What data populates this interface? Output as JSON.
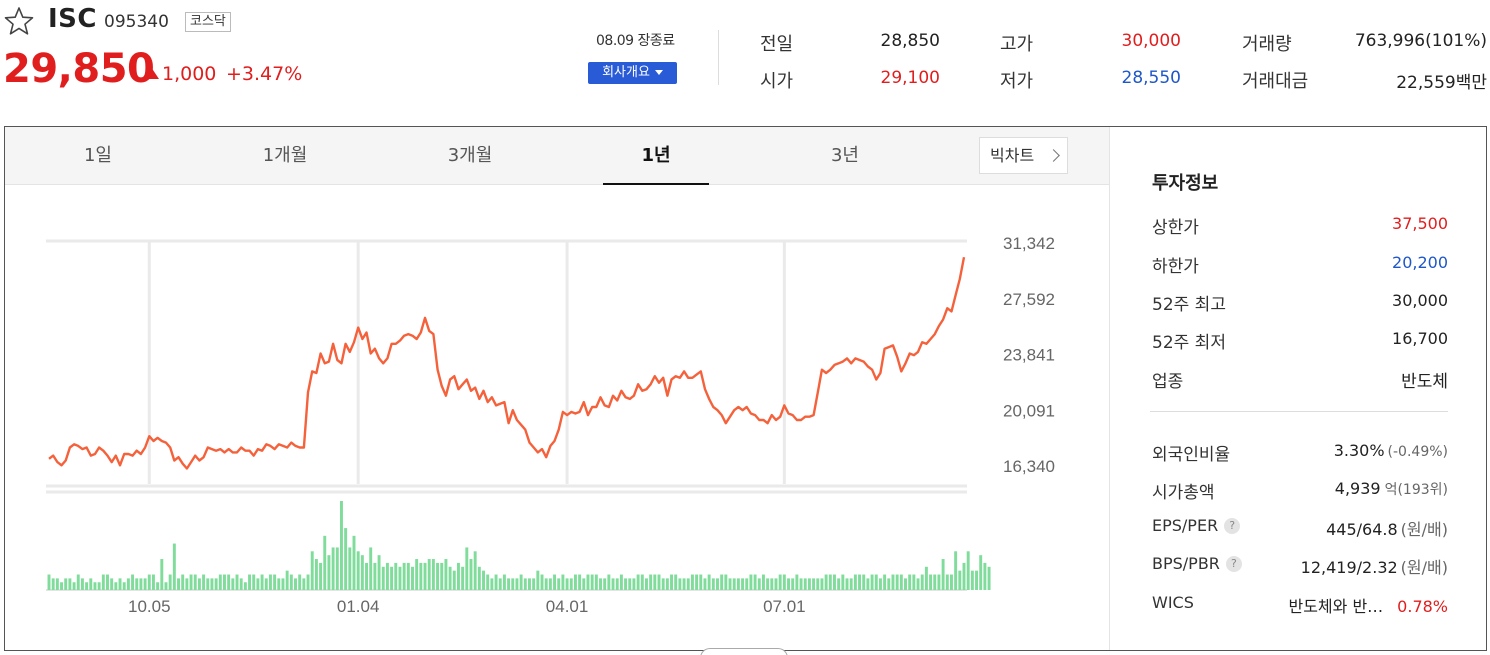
{
  "header": {
    "name": "ISC",
    "code": "095340",
    "market": "코스닥",
    "price": "29,850",
    "change": "1,000",
    "change_pct": "+3.47%",
    "trade_date": "08.09 장종료",
    "company_button": "회사개요",
    "stats": {
      "prev_close_label": "전일",
      "prev_close": "28,850",
      "open_label": "시가",
      "open": "29,100",
      "high_label": "고가",
      "high": "30,000",
      "low_label": "저가",
      "low": "28,550",
      "volume_label": "거래량",
      "volume": "763,996(101%)",
      "value_label": "거래대금",
      "value": "22,559백만"
    },
    "colors": {
      "up": "#e01e1e",
      "down": "#1e57c8",
      "accent": "#2a5bd7"
    }
  },
  "tabs": [
    "1일",
    "1개월",
    "3개월",
    "1년",
    "3년"
  ],
  "active_tab": "1년",
  "bigchart_label": "빅차트",
  "chart_data": {
    "type": "line",
    "title": "",
    "xlabel": "",
    "ylabel": "",
    "y_ticks": [
      "31,342",
      "27,592",
      "23,841",
      "20,091",
      "16,340"
    ],
    "ylim": [
      16340,
      31342
    ],
    "x_ticks": [
      "10.05",
      "01.04",
      "04.01",
      "07.01"
    ],
    "line_color": "#f5613b",
    "volume_color": "#7fdc9a",
    "grid": true,
    "series": [
      {
        "values": [
          17400,
          17600,
          17200,
          17000,
          17300,
          18100,
          18300,
          18200,
          18000,
          18100,
          17600,
          17700,
          18100,
          17900,
          17600,
          17200,
          17600,
          17000,
          17700,
          17700,
          17600,
          17900,
          17700,
          18100,
          18800,
          18500,
          18700,
          18500,
          18400,
          18100,
          17300,
          17500,
          17100,
          16800,
          17200,
          17600,
          17300,
          17500,
          18100,
          18000,
          17900,
          18000,
          17800,
          18000,
          17800,
          17800,
          18100,
          17900,
          17900,
          17600,
          18000,
          17900,
          18300,
          18200,
          18000,
          18300,
          18200,
          18100,
          18400,
          18200,
          18100,
          18100,
          21500,
          22800,
          22700,
          23900,
          23300,
          23400,
          24500,
          23500,
          23300,
          24500,
          24000,
          24600,
          25500,
          24800,
          25200,
          23900,
          24200,
          23600,
          23300,
          23600,
          24500,
          24500,
          24700,
          25000,
          25100,
          25000,
          24800,
          25200,
          26100,
          25300,
          25100,
          22900,
          21900,
          21300,
          22300,
          22500,
          21700,
          22000,
          22300,
          21600,
          21800,
          21100,
          21600,
          20900,
          21200,
          20700,
          20800,
          20900,
          19600,
          20400,
          19800,
          19500,
          19200,
          18400,
          18100,
          17800,
          18000,
          17500,
          18200,
          18500,
          19200,
          20300,
          20100,
          20300,
          20200,
          20300,
          20900,
          20100,
          20600,
          20600,
          21200,
          20700,
          20600,
          21300,
          21000,
          21600,
          21200,
          21100,
          21300,
          22000,
          21600,
          21700,
          22000,
          22500,
          22100,
          22400,
          21300,
          22300,
          22500,
          22400,
          22800,
          22400,
          22400,
          22600,
          22800,
          21700,
          21100,
          20600,
          20400,
          20100,
          19600,
          20000,
          20400,
          20600,
          20400,
          20600,
          20200,
          20100,
          19800,
          19800,
          19600,
          20100,
          19800,
          20000,
          20700,
          20200,
          20100,
          19800,
          19800,
          20000,
          20000,
          20100,
          21500,
          22900,
          22700,
          22900,
          23200,
          23300,
          23400,
          23600,
          23300,
          23600,
          23500,
          23400,
          23100,
          22900,
          22300,
          22700,
          24200,
          24300,
          24400,
          23700,
          22800,
          23300,
          23900,
          23800,
          24000,
          24600,
          24500,
          24800,
          25100,
          25600,
          26000,
          26700,
          26500,
          27500,
          28500,
          29850
        ]
      }
    ],
    "volume": [
      4,
      3,
      3,
      2,
      3,
      3,
      2,
      4,
      3,
      2,
      3,
      2,
      2,
      4,
      4,
      3,
      2,
      3,
      2,
      3,
      4,
      3,
      3,
      3,
      4,
      4,
      2,
      8,
      2,
      4,
      12,
      3,
      4,
      3,
      4,
      4,
      3,
      4,
      3,
      3,
      3,
      4,
      4,
      4,
      3,
      4,
      3,
      2,
      4,
      4,
      3,
      4,
      3,
      4,
      4,
      3,
      3,
      5,
      4,
      3,
      4,
      3,
      4,
      10,
      8,
      7,
      14,
      9,
      11,
      11,
      23,
      16,
      11,
      14,
      10,
      9,
      7,
      11,
      7,
      9,
      6,
      7,
      6,
      7,
      6,
      7,
      7,
      6,
      8,
      7,
      7,
      8,
      8,
      7,
      7,
      8,
      6,
      5,
      7,
      6,
      11,
      8,
      10,
      6,
      5,
      4,
      3,
      4,
      3,
      4,
      3,
      3,
      3,
      4,
      3,
      3,
      3,
      5,
      4,
      3,
      3,
      4,
      3,
      4,
      3,
      3,
      4,
      4,
      3,
      4,
      4,
      4,
      3,
      3,
      4,
      3,
      3,
      4,
      3,
      3,
      3,
      4,
      4,
      3,
      4,
      4,
      4,
      3,
      3,
      4,
      4,
      3,
      3,
      3,
      4,
      4,
      4,
      3,
      4,
      3,
      3,
      4,
      4,
      3,
      3,
      3,
      3,
      3,
      4,
      4,
      3,
      4,
      3,
      3,
      3,
      4,
      4,
      3,
      3,
      4,
      3,
      3,
      3,
      3,
      3,
      3,
      4,
      4,
      4,
      3,
      4,
      3,
      3,
      4,
      4,
      4,
      3,
      4,
      4,
      3,
      4,
      3,
      4,
      4,
      4,
      3,
      4,
      4,
      3,
      4,
      6,
      4,
      4,
      4,
      8,
      4,
      4,
      10,
      5,
      7,
      10,
      5,
      5,
      9,
      7,
      6
    ]
  },
  "panel": {
    "title": "투자정보",
    "rows": [
      {
        "label": "상한가",
        "value": "37,500"
      },
      {
        "label": "하한가",
        "value": "20,200"
      },
      {
        "label": "52주 최고",
        "value": "30,000"
      },
      {
        "label": "52주 최저",
        "value": "16,700"
      },
      {
        "label": "업종",
        "value": "반도체"
      }
    ],
    "foreign_label": "외국인비율",
    "foreign_value": "3.30%",
    "foreign_change": "(-0.49%)",
    "mcap_label": "시가총액",
    "mcap_value": "4,939",
    "mcap_unit": "억(193위)",
    "eps_label": "EPS/PER",
    "eps_value": "445/64.8",
    "eps_unit": "(원/배)",
    "bps_label": "BPS/PBR",
    "bps_value": "12,419/2.32",
    "bps_unit": "(원/배)",
    "wics_label": "WICS",
    "wics_value": "반도체와 반…",
    "wics_change": "0.78%",
    "help": "?"
  }
}
